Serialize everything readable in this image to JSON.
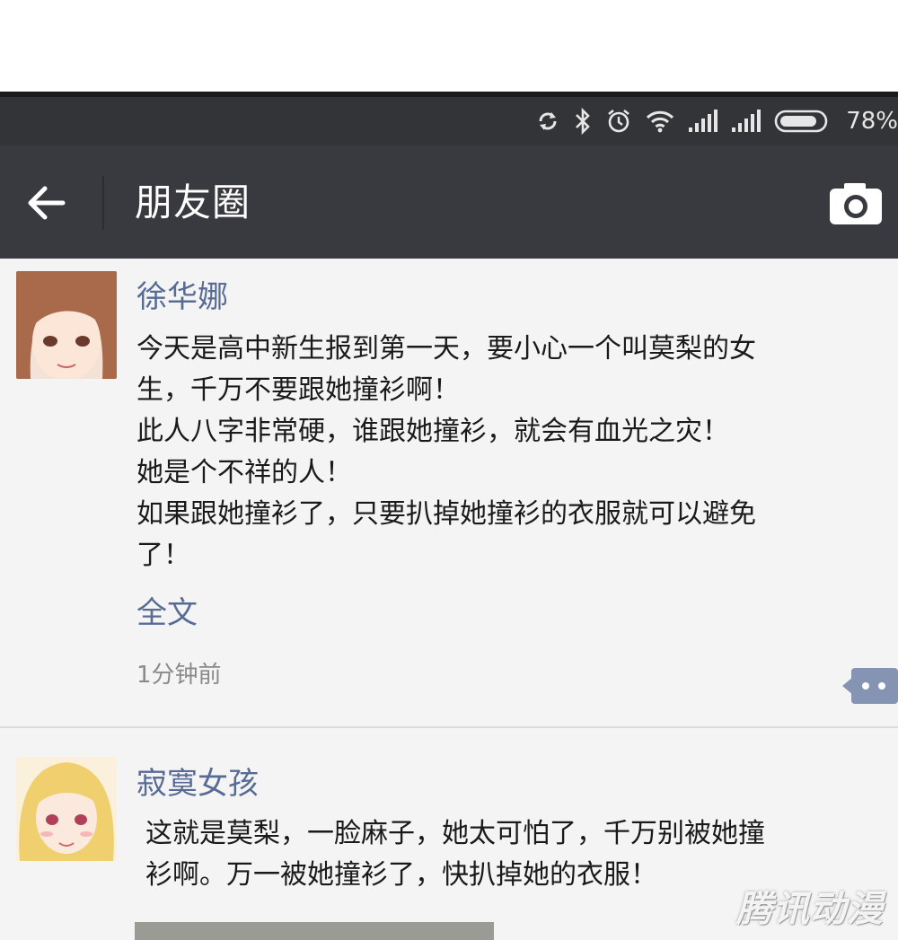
{
  "status_bar": {
    "battery_pct": "78%",
    "icons": [
      "sync-icon",
      "bluetooth-icon",
      "alarm-icon",
      "wifi-icon",
      "signal-icon",
      "signal-icon",
      "battery-icon"
    ]
  },
  "nav": {
    "title": "朋友圈",
    "back_icon": "back-arrow-icon",
    "camera_icon": "camera-icon"
  },
  "posts": [
    {
      "username": "徐华娜",
      "lines": [
        "今天是高中新生报到第一天，要小心一个叫莫梨的女",
        "生，千万不要跟她撞衫啊！",
        "此人八字非常硬，谁跟她撞衫，就会有血光之灾！",
        "她是个不祥的人！",
        "如果跟她撞衫了，只要扒掉她撞衫的衣服就可以避免",
        "了！"
      ],
      "fulltext_label": "全文",
      "time": "1分钟前",
      "avatar_hair_color": "#a86a4a"
    },
    {
      "username": "寂寞女孩",
      "lines": [
        "这就是莫梨，一脸麻子，她太可怕了，千万别被她撞",
        "衫啊。万一被她撞衫了，快扒掉她的衣服！"
      ],
      "avatar_hair_color": "#f0cf6e"
    }
  ],
  "colors": {
    "link": "#576b95",
    "nav_bg": "#393a3f",
    "status_bg": "#323437"
  },
  "watermark": "腾讯动漫"
}
